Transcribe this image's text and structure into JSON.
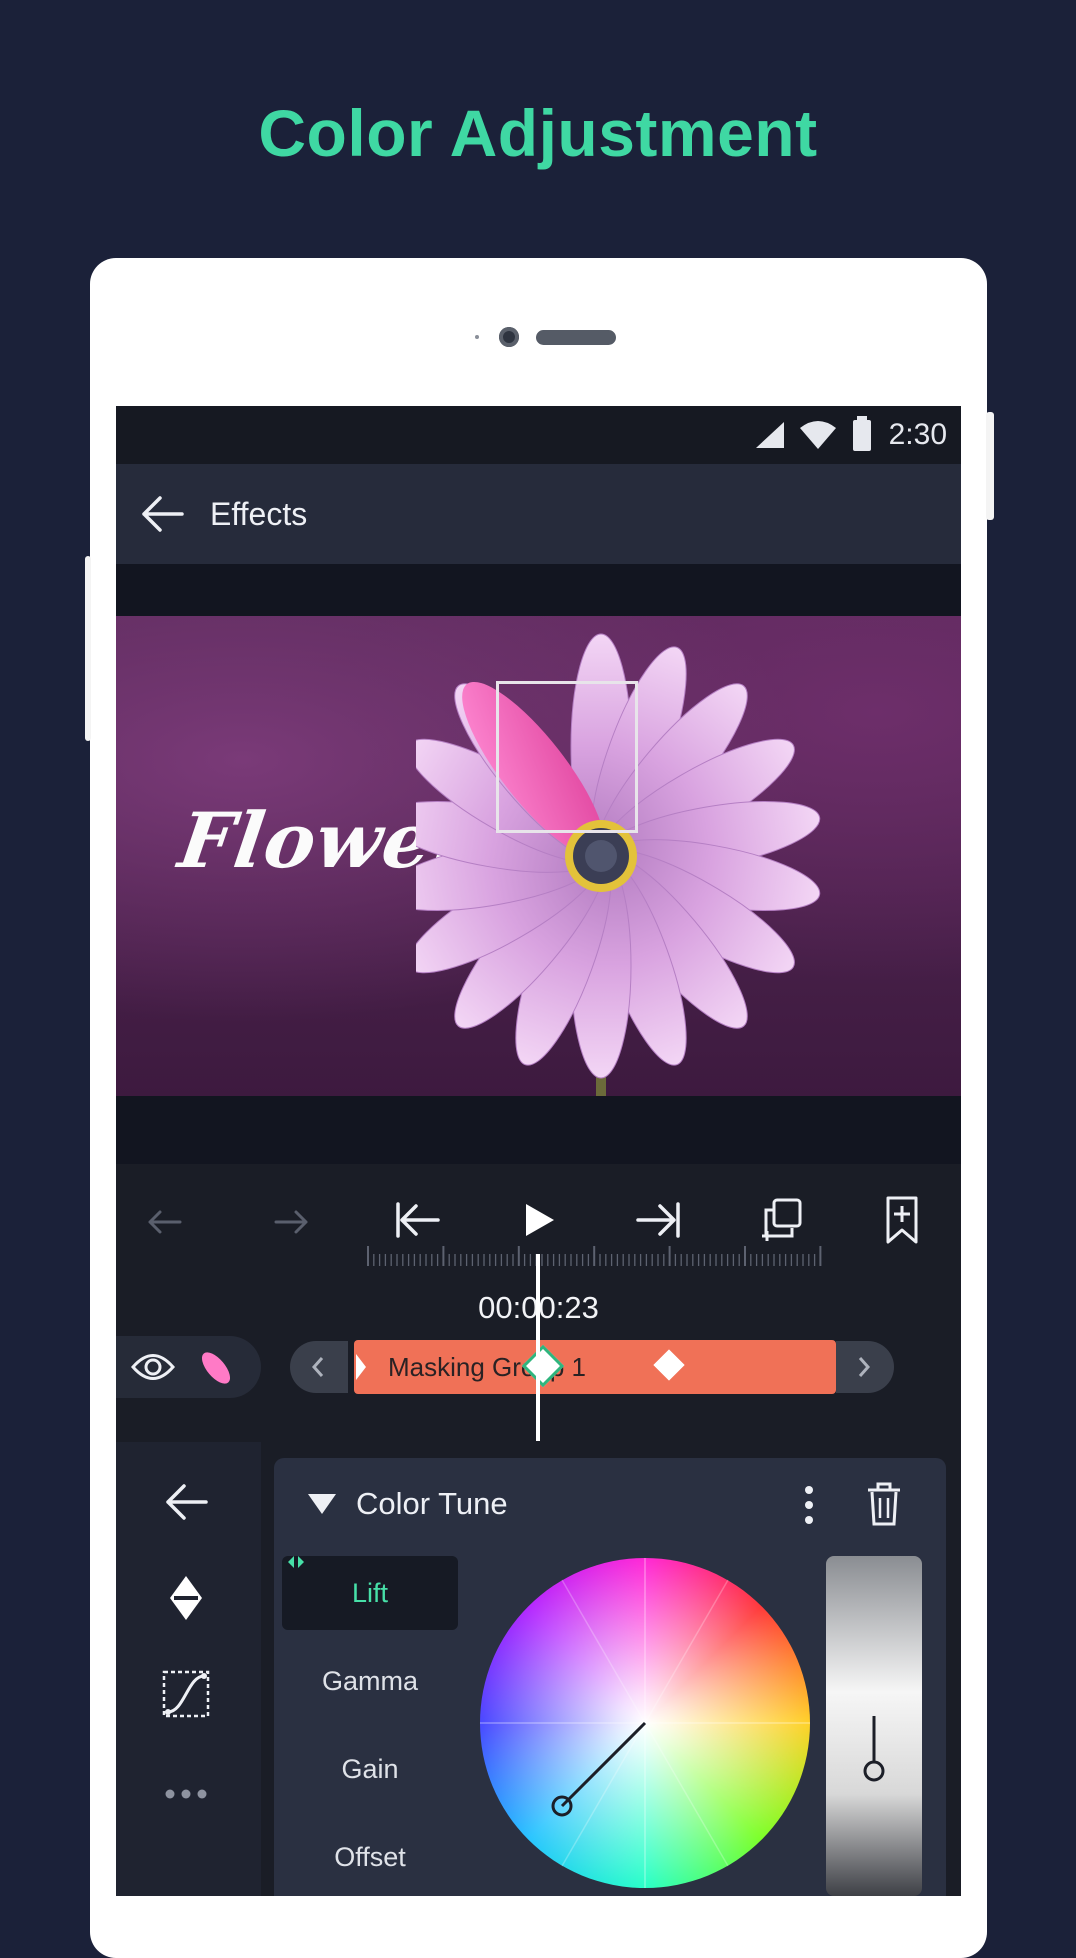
{
  "promo": {
    "title": "Color Adjustment"
  },
  "status_bar": {
    "time": "2:30"
  },
  "app_bar": {
    "title": "Effects"
  },
  "preview": {
    "overlay_text": "Flower"
  },
  "playback": {
    "timecode": "00:00:23"
  },
  "timeline": {
    "clip_label": "Masking Group 1"
  },
  "color_tune": {
    "title": "Color Tune",
    "tabs": [
      "Lift",
      "Gamma",
      "Gain",
      "Offset"
    ],
    "active_tab": "Lift"
  },
  "colors": {
    "accent": "#3fd8a3",
    "background": "#1b2139",
    "clip": "#f07157",
    "panel": "#2a3041"
  },
  "icons": {
    "appbar": "arrow-left-icon",
    "controls": [
      "undo-icon",
      "redo-icon",
      "skip-to-start-icon",
      "play-icon",
      "skip-to-end-icon",
      "copy-add-icon",
      "bookmark-add-icon"
    ],
    "rail": [
      "back-arrow-icon",
      "keyframe-icon",
      "curve-icon",
      "more-icon"
    ]
  }
}
